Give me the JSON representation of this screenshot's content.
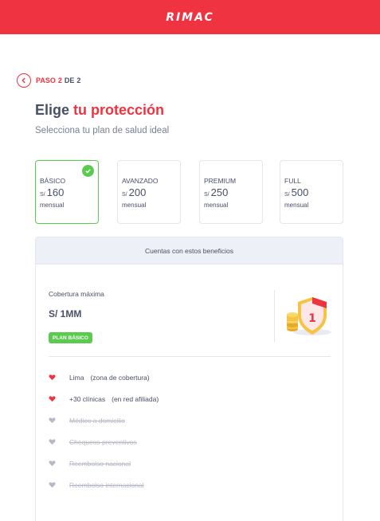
{
  "header": {
    "brand": "RIMAC"
  },
  "step": {
    "paso": "PASO",
    "current": "2",
    "de": "DE",
    "total": "2"
  },
  "title": {
    "lead": "Elige",
    "accent": "tu protección"
  },
  "subtitle": "Selecciona tu plan de salud ideal",
  "plans": [
    {
      "name": "BÁSICO",
      "currency": "S/",
      "amount": "160",
      "period": "mensual",
      "selected": true
    },
    {
      "name": "AVANZADO",
      "currency": "S/",
      "amount": "200",
      "period": "mensual",
      "selected": false
    },
    {
      "name": "PREMIUM",
      "currency": "S/",
      "amount": "250",
      "period": "mensual",
      "selected": false
    },
    {
      "name": "FULL",
      "currency": "S/",
      "amount": "500",
      "period": "mensual",
      "selected": false
    }
  ],
  "benefits": {
    "header": "Cuentas con estos beneficios",
    "coverage_label": "Cobertura máxima",
    "coverage_value": "S/ 1MM",
    "plan_badge": "PLAN BÁSICO",
    "items": [
      {
        "name": "Lima",
        "note": "(zona de cobertura)",
        "included": true
      },
      {
        "name": "+30 clínicas",
        "note": "(en red afiliada)",
        "included": true
      },
      {
        "name": "Médico a domicilio",
        "note": "",
        "included": false
      },
      {
        "name": "Chequeos preventivos",
        "note": "",
        "included": false
      },
      {
        "name": "Reembolso nacional",
        "note": "",
        "included": false
      },
      {
        "name": "Reembolso internacional",
        "note": "",
        "included": false
      }
    ]
  },
  "colors": {
    "brand_red": "#ef3340",
    "success_green": "#5bcb4f",
    "text": "#494f66",
    "disabled": "#b4b8c8"
  },
  "icons": {
    "back": "chevron-left-icon",
    "check": "check-circle-icon",
    "heart": "heart-icon",
    "shield": "shield-coins-icon"
  }
}
